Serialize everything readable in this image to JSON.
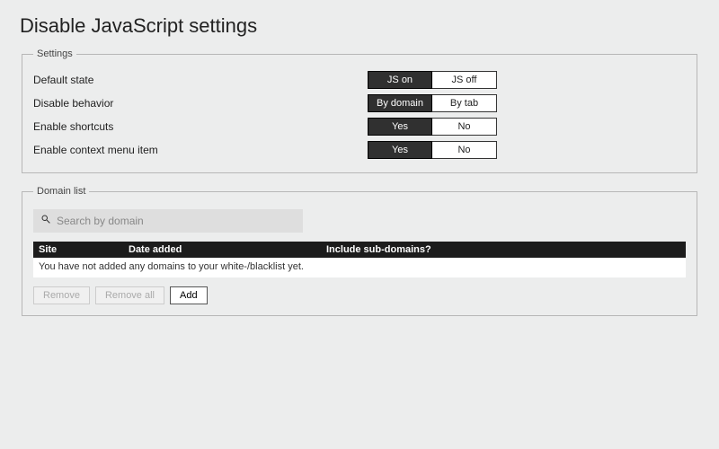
{
  "title": "Disable JavaScript settings",
  "settings_legend": "Settings",
  "rows": [
    {
      "label": "Default state",
      "optA": "JS on",
      "optB": "JS off",
      "active": "A"
    },
    {
      "label": "Disable behavior",
      "optA": "By domain",
      "optB": "By tab",
      "active": "A"
    },
    {
      "label": "Enable shortcuts",
      "optA": "Yes",
      "optB": "No",
      "active": "A"
    },
    {
      "label": "Enable context menu item",
      "optA": "Yes",
      "optB": "No",
      "active": "A"
    }
  ],
  "domain_legend": "Domain list",
  "search_placeholder": "Search by domain",
  "columns": {
    "site": "Site",
    "date": "Date added",
    "sub": "Include sub-domains?"
  },
  "empty_message": "You have not added any domains to your white-/blacklist yet.",
  "buttons": {
    "remove": "Remove",
    "remove_all": "Remove all",
    "add": "Add"
  }
}
